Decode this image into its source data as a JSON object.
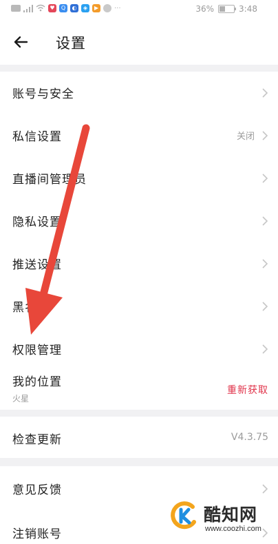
{
  "status_bar": {
    "battery_text": "36%",
    "time": "3:48"
  },
  "header": {
    "title": "设置"
  },
  "settings": {
    "account_security": {
      "label": "账号与安全"
    },
    "private_message": {
      "label": "私信设置",
      "value": "关闭"
    },
    "live_admin": {
      "label": "直播间管理员"
    },
    "privacy": {
      "label": "隐私设置"
    },
    "push": {
      "label": "推送设置"
    },
    "blacklist": {
      "label": "黑名单"
    },
    "permissions": {
      "label": "权限管理"
    },
    "location": {
      "label": "我的位置",
      "sub": "火星",
      "action": "重新获取"
    },
    "check_update": {
      "label": "检查更新",
      "value": "V4.3.75"
    },
    "feedback": {
      "label": "意见反馈"
    },
    "cancel_account": {
      "label": "注销账号"
    }
  },
  "watermark": {
    "brand": "酷知网",
    "url": "www.coozhi.com"
  },
  "colors": {
    "accent_red": "#e0334a",
    "arrow_red": "#e8473a",
    "background": "#f1f1f3"
  }
}
